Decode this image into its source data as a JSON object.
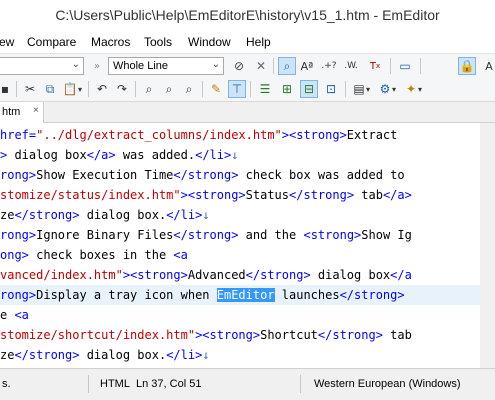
{
  "window": {
    "title": "C:\\Users\\Public\\Help\\EmEditorE\\history\\v15_1.htm - EmEditor"
  },
  "menu": {
    "items": [
      "ew",
      "Compare",
      "Macros",
      "Tools",
      "Window",
      "Help"
    ]
  },
  "toolbar": {
    "search_combo_value": "",
    "search_scope_value": "Whole Line"
  },
  "tabs": [
    {
      "label": "htm",
      "close": "×"
    }
  ],
  "editor": {
    "lines": [
      [
        {
          "c": "t-tag",
          "t": "href="
        },
        {
          "c": "t-str",
          "t": "\"../dlg/extract_columns/index.htm\""
        },
        {
          "c": "t-tag",
          "t": "><strong>"
        },
        {
          "c": "t-txt",
          "t": "Extract "
        }
      ],
      [
        {
          "c": "t-tag",
          "t": "> "
        },
        {
          "c": "t-txt",
          "t": "dialog box"
        },
        {
          "c": "t-tag",
          "t": "</a>"
        },
        {
          "c": "t-txt",
          "t": " was added."
        },
        {
          "c": "t-tag",
          "t": "</li>"
        },
        {
          "c": "t-ret",
          "t": "↓"
        }
      ],
      [
        {
          "c": "t-tag",
          "t": "rong>"
        },
        {
          "c": "t-txt",
          "t": "Show Execution Time"
        },
        {
          "c": "t-tag",
          "t": "</strong>"
        },
        {
          "c": "t-txt",
          "t": " check box was added to "
        }
      ],
      [
        {
          "c": "t-str",
          "t": "stomize/status/index.htm\""
        },
        {
          "c": "t-tag",
          "t": "><strong>"
        },
        {
          "c": "t-txt",
          "t": "Status"
        },
        {
          "c": "t-tag",
          "t": "</strong>"
        },
        {
          "c": "t-txt",
          "t": " tab"
        },
        {
          "c": "t-tag",
          "t": "</a>"
        }
      ],
      [
        {
          "c": "t-txt",
          "t": "ze"
        },
        {
          "c": "t-tag",
          "t": "</strong>"
        },
        {
          "c": "t-txt",
          "t": " dialog box."
        },
        {
          "c": "t-tag",
          "t": "</li>"
        },
        {
          "c": "t-ret",
          "t": "↓"
        }
      ],
      [
        {
          "c": "t-tag",
          "t": "rong>"
        },
        {
          "c": "t-txt",
          "t": "Ignore Binary Files"
        },
        {
          "c": "t-tag",
          "t": "</strong>"
        },
        {
          "c": "t-txt",
          "t": " and the "
        },
        {
          "c": "t-tag",
          "t": "<strong>"
        },
        {
          "c": "t-txt",
          "t": "Show Ig"
        }
      ],
      [
        {
          "c": "t-tag",
          "t": "ong>"
        },
        {
          "c": "t-txt",
          "t": " check boxes in the "
        },
        {
          "c": "t-tag",
          "t": "<a"
        }
      ],
      [
        {
          "c": "t-str",
          "t": "vanced/index.htm\""
        },
        {
          "c": "t-tag",
          "t": "><strong>"
        },
        {
          "c": "t-txt",
          "t": "Advanced"
        },
        {
          "c": "t-tag",
          "t": "</strong>"
        },
        {
          "c": "t-txt",
          "t": " dialog box"
        },
        {
          "c": "t-tag",
          "t": "</a"
        }
      ],
      [
        {
          "c": "t-tag",
          "t": "rong>"
        },
        {
          "c": "t-txt",
          "t": "Display a tray icon when "
        },
        {
          "c": "t-sel",
          "t": "EmEditor"
        },
        {
          "c": "t-txt",
          "t": " launches"
        },
        {
          "c": "t-tag",
          "t": "</strong> "
        }
      ],
      [
        {
          "c": "t-txt",
          "t": "e "
        },
        {
          "c": "t-tag",
          "t": "<a"
        }
      ],
      [
        {
          "c": "t-str",
          "t": "stomize/shortcut/index.htm\""
        },
        {
          "c": "t-tag",
          "t": "><strong>"
        },
        {
          "c": "t-txt",
          "t": "Shortcut"
        },
        {
          "c": "t-tag",
          "t": "</strong>"
        },
        {
          "c": "t-txt",
          "t": " tab"
        }
      ],
      [
        {
          "c": "t-txt",
          "t": "ze"
        },
        {
          "c": "t-tag",
          "t": "</strong>"
        },
        {
          "c": "t-txt",
          "t": " dialog box."
        },
        {
          "c": "t-tag",
          "t": "</li>"
        },
        {
          "c": "t-ret",
          "t": "↓"
        }
      ]
    ],
    "current_line_index": 8
  },
  "status": {
    "left": "s.",
    "mode": "HTML",
    "position": "Ln 37, Col 51",
    "encoding": "Western European (Windows)"
  }
}
